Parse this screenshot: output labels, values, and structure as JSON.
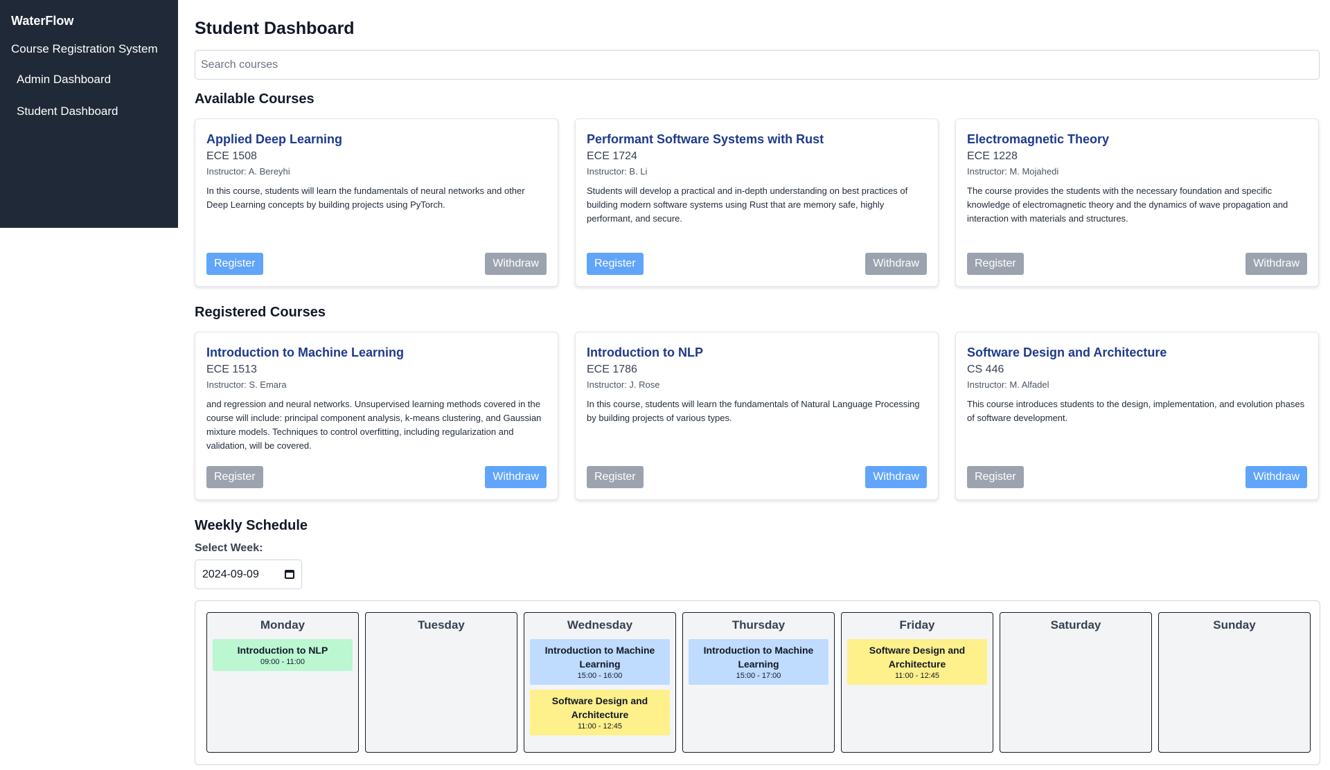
{
  "sidebar": {
    "brand": "WaterFlow",
    "subtitle": "Course Registration System",
    "items": [
      {
        "label": "Admin Dashboard"
      },
      {
        "label": "Student Dashboard"
      }
    ]
  },
  "page_title": "Student Dashboard",
  "search": {
    "placeholder": "Search courses",
    "value": ""
  },
  "available": {
    "title": "Available Courses",
    "courses": [
      {
        "title": "Applied Deep Learning",
        "code": "ECE 1508",
        "instructor": "Instructor: A. Bereyhi",
        "description": "In this course, students will learn the fundamentals of neural networks and other Deep Learning concepts by building projects using PyTorch.",
        "register": "Register",
        "withdraw": "Withdraw"
      },
      {
        "title": "Performant Software Systems with Rust",
        "code": "ECE 1724",
        "instructor": "Instructor: B. Li",
        "description": "Students will develop a practical and in-depth understanding on best practices of building modern software systems using Rust that are memory safe, highly performant, and secure.",
        "register": "Register",
        "withdraw": "Withdraw"
      },
      {
        "title": "Electromagnetic Theory",
        "code": "ECE 1228",
        "instructor": "Instructor: M. Mojahedi",
        "description": "The course provides the students with the necessary foundation and specific knowledge of electromagnetic theory and the dynamics of wave propagation and interaction with materials and structures.",
        "register": "Register",
        "withdraw": "Withdraw"
      }
    ]
  },
  "registered": {
    "title": "Registered Courses",
    "courses": [
      {
        "title": "Introduction to Machine Learning",
        "code": "ECE 1513",
        "instructor": "Instructor: S. Emara",
        "description": "and regression and neural networks. Unsupervised learning methods covered in the course will include: principal component analysis, k-means clustering, and Gaussian mixture models. Techniques to control overfitting, including regularization and validation, will be covered.",
        "register": "Register",
        "withdraw": "Withdraw"
      },
      {
        "title": "Introduction to NLP",
        "code": "ECE 1786",
        "instructor": "Instructor: J. Rose",
        "description": "In this course, students will learn the fundamentals of Natural Language Processing by building projects of various types.",
        "register": "Register",
        "withdraw": "Withdraw"
      },
      {
        "title": "Software Design and Architecture",
        "code": "CS 446",
        "instructor": "Instructor: M. Alfadel",
        "description": "This course introduces students to the design, implementation, and evolution phases of software development.",
        "register": "Register",
        "withdraw": "Withdraw"
      }
    ]
  },
  "schedule": {
    "title": "Weekly Schedule",
    "week_label": "Select Week:",
    "week_value": "2024-09-09",
    "days": [
      {
        "name": "Monday",
        "events": [
          {
            "name": "Introduction to NLP",
            "time": "09:00 - 11:00",
            "color": "#bbf7d0"
          }
        ]
      },
      {
        "name": "Tuesday",
        "events": []
      },
      {
        "name": "Wednesday",
        "events": [
          {
            "name": "Introduction to Machine Learning",
            "time": "15:00 - 16:00",
            "color": "#bfdbfe"
          },
          {
            "name": "Software Design and Architecture",
            "time": "11:00 - 12:45",
            "color": "#fef08a"
          }
        ]
      },
      {
        "name": "Thursday",
        "events": [
          {
            "name": "Introduction to Machine Learning",
            "time": "15:00 - 17:00",
            "color": "#bfdbfe"
          }
        ]
      },
      {
        "name": "Friday",
        "events": [
          {
            "name": "Software Design and Architecture",
            "time": "11:00 - 12:45",
            "color": "#fef08a"
          }
        ]
      },
      {
        "name": "Saturday",
        "events": []
      },
      {
        "name": "Sunday",
        "events": []
      }
    ]
  },
  "colors": {
    "sidebar_bg": "#1f2937",
    "course_title": "#1e3a8a",
    "button_active": "#60a5fa",
    "button_inactive": "#9ca3af"
  }
}
